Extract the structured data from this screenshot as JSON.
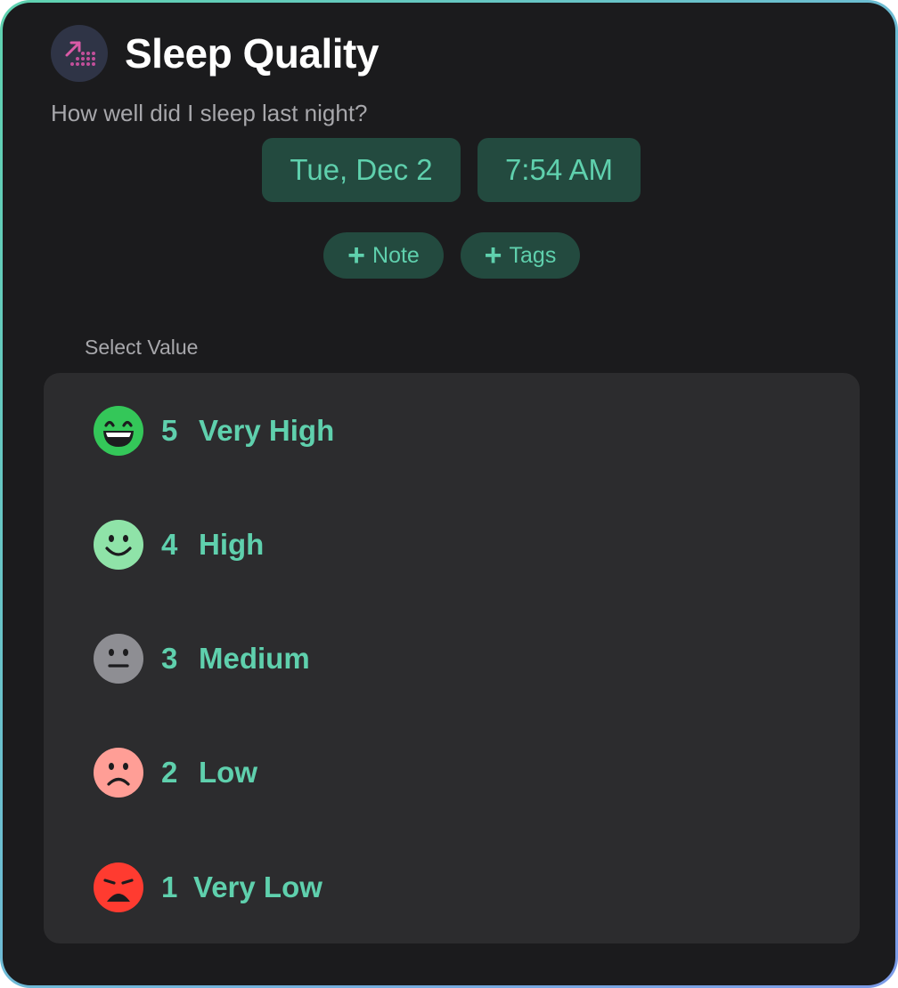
{
  "header": {
    "title": "Sleep Quality",
    "subtitle": "How well did I sleep last night?",
    "app_icon": "trend-up-grid-icon"
  },
  "datetime": {
    "date": "Tue, Dec 2",
    "time": "7:54 AM"
  },
  "actions": {
    "note_label": "Note",
    "tags_label": "Tags",
    "plus_glyph": "+"
  },
  "select_label": "Select Value",
  "options": [
    {
      "value": "5",
      "label": "Very High",
      "icon": "grinning-face-icon",
      "color": "#34c759"
    },
    {
      "value": "4",
      "label": "High",
      "icon": "smiling-face-icon",
      "color": "#8fe3a8"
    },
    {
      "value": "3",
      "label": "Medium",
      "icon": "neutral-face-icon",
      "color": "#8e8e93"
    },
    {
      "value": "2",
      "label": "Low",
      "icon": "frowning-face-icon",
      "color": "#ff9e96"
    },
    {
      "value": "1",
      "label": "Very Low",
      "icon": "distressed-face-icon",
      "color": "#ff3b30"
    }
  ],
  "colors": {
    "accent": "#5fd0ad",
    "chip_bg": "#234a3f",
    "panel_bg": "#1b1b1d",
    "list_bg": "#2c2c2e"
  }
}
